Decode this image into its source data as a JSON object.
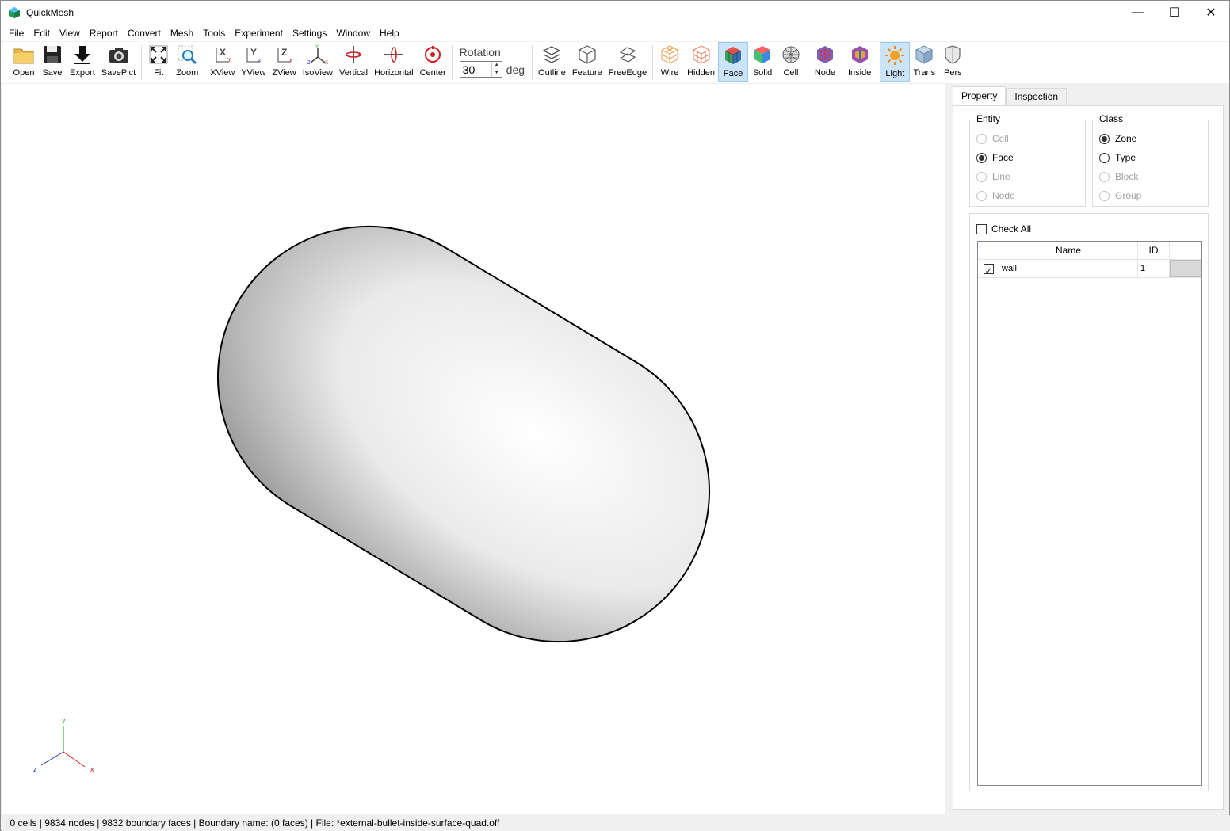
{
  "window": {
    "title": "QuickMesh",
    "controls": {
      "minimize": "—",
      "maximize": "☐",
      "close": "✕"
    }
  },
  "menubar": {
    "items": [
      "File",
      "Edit",
      "View",
      "Report",
      "Convert",
      "Mesh",
      "Tools",
      "Experiment",
      "Settings",
      "Window",
      "Help"
    ]
  },
  "toolbar": {
    "open": "Open",
    "save": "Save",
    "export": "Export",
    "savepict": "SavePict",
    "fit": "Fit",
    "zoom": "Zoom",
    "xview": "XView",
    "yview": "YView",
    "zview": "ZView",
    "isoview": "IsoView",
    "vertical": "Vertical",
    "horizontal": "Horizontal",
    "center": "Center",
    "rotation_label": "Rotation",
    "rotation_value": "30",
    "rotation_unit": "deg",
    "outline": "Outline",
    "feature": "Feature",
    "freeedge": "FreeEdge",
    "wire": "Wire",
    "hidden": "Hidden",
    "face": "Face",
    "solid": "Solid",
    "cell": "Cell",
    "node": "Node",
    "inside": "Inside",
    "light": "Light",
    "trans": "Trans",
    "pers": "Pers",
    "active_buttons": [
      "face",
      "light"
    ]
  },
  "axes": {
    "x": "x",
    "y": "y",
    "z": "z"
  },
  "panel": {
    "tabs": {
      "property": "Property",
      "inspection": "Inspection",
      "selected": "Property"
    },
    "entity": {
      "title": "Entity",
      "options": {
        "cell": "Cell",
        "face": "Face",
        "line": "Line",
        "node": "Node"
      },
      "selected": "Face"
    },
    "class": {
      "title": "Class",
      "options": {
        "zone": "Zone",
        "type": "Type",
        "block": "Block",
        "group": "Group"
      },
      "selected": "Zone"
    },
    "check_all": "Check All",
    "table": {
      "headers": {
        "name": "Name",
        "id": "ID"
      },
      "rows": [
        {
          "checked": true,
          "name": "wall",
          "id": "1",
          "color": "#d9d9d9"
        }
      ]
    }
  },
  "status": {
    "text": "| 0 cells | 9834 nodes | 9832 boundary faces |  Boundary name:  (0 faces) | File: *external-bullet-inside-surface-quad.off"
  },
  "colors": {
    "active_button_bg": "#cce4f7",
    "mesh_face": "#e8e8e8",
    "mesh_line": "#000000",
    "axis_x": "#d02020",
    "axis_y": "#20a020",
    "axis_z": "#2030c0"
  }
}
